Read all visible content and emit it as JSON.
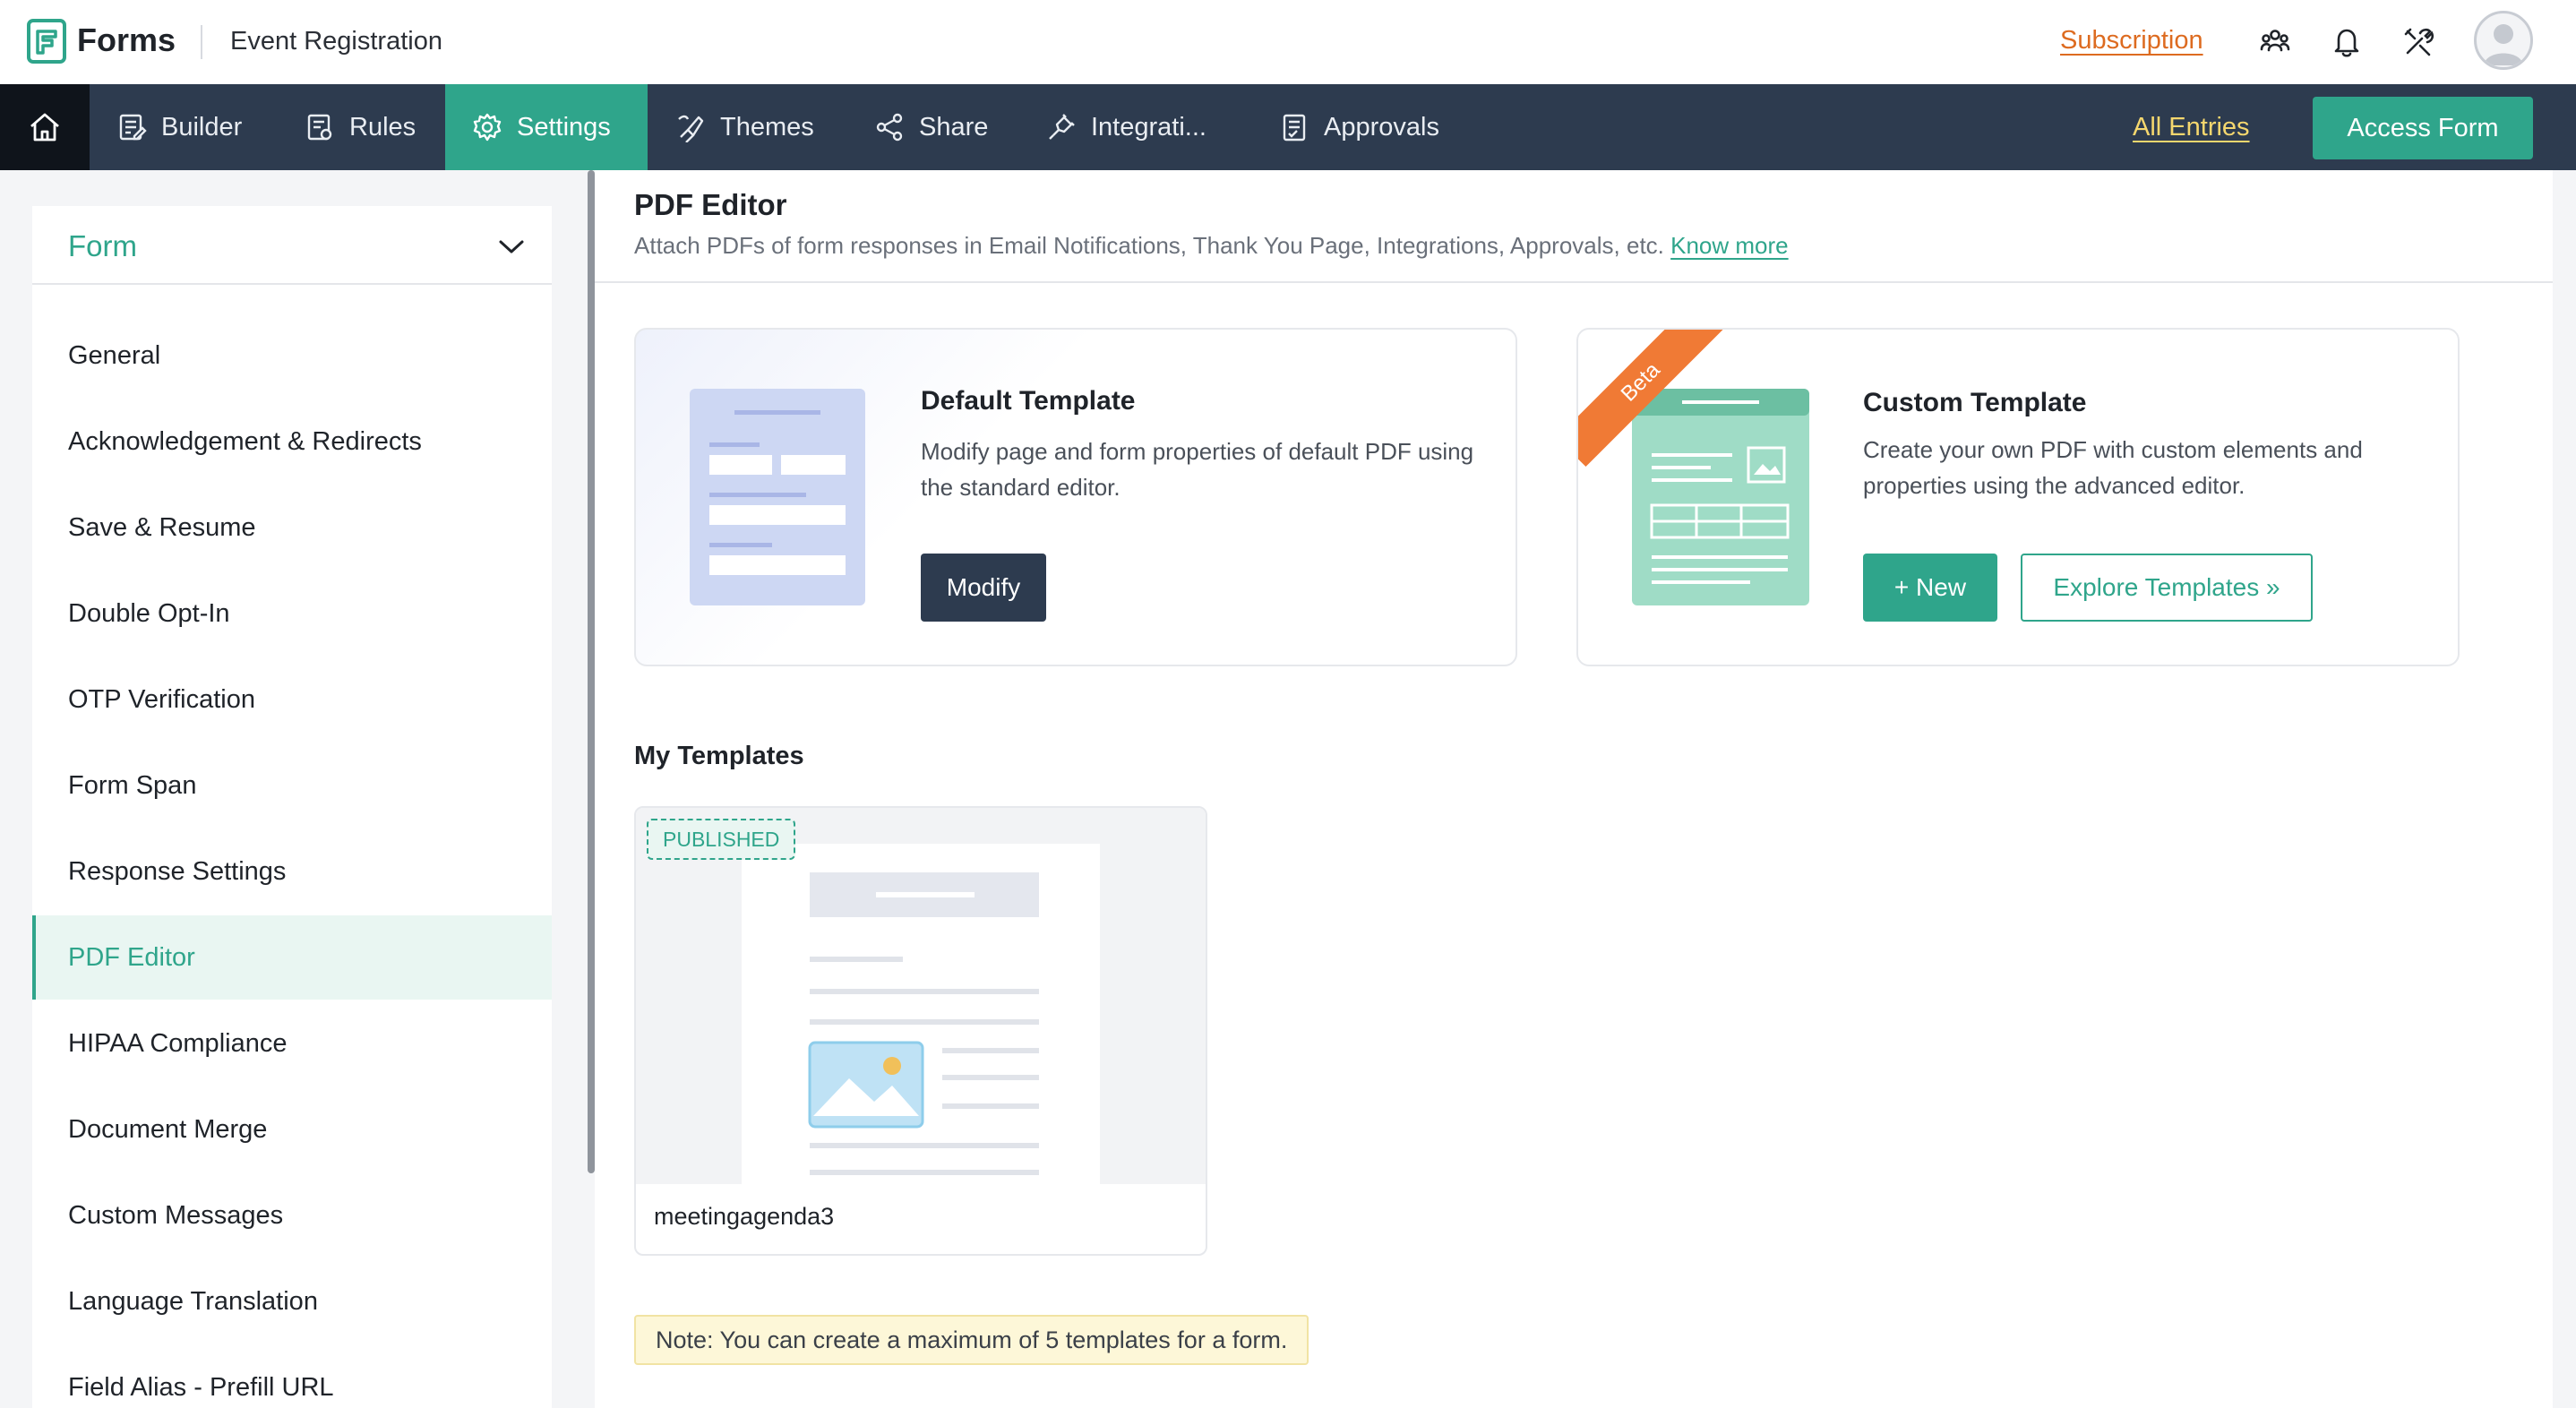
{
  "header": {
    "app_name": "Forms",
    "form_name": "Event Registration",
    "subscription_label": "Subscription",
    "icons": [
      "users-icon",
      "bell-icon",
      "tools-icon",
      "avatar"
    ]
  },
  "nav": {
    "home_icon": "home-icon",
    "tabs": [
      {
        "label": "Builder",
        "icon": "builder-icon"
      },
      {
        "label": "Rules",
        "icon": "rules-icon"
      },
      {
        "label": "Settings",
        "icon": "gear-icon"
      },
      {
        "label": "Themes",
        "icon": "themes-icon"
      },
      {
        "label": "Share",
        "icon": "share-icon"
      },
      {
        "label": "Integrati...",
        "icon": "integrations-icon"
      },
      {
        "label": "Approvals",
        "icon": "approvals-icon"
      }
    ],
    "active_tab": "Settings",
    "all_entries_label": "All Entries",
    "access_form_label": "Access Form"
  },
  "sidebar": {
    "dropdown_label": "Form",
    "items": [
      {
        "label": "General"
      },
      {
        "label": "Acknowledgement & Redirects"
      },
      {
        "label": "Save & Resume"
      },
      {
        "label": "Double Opt-In"
      },
      {
        "label": "OTP Verification"
      },
      {
        "label": "Form Span"
      },
      {
        "label": "Response Settings"
      },
      {
        "label": "PDF Editor"
      },
      {
        "label": "HIPAA Compliance"
      },
      {
        "label": "Document Merge"
      },
      {
        "label": "Custom Messages"
      },
      {
        "label": "Language Translation"
      },
      {
        "label": "Field Alias - Prefill URL"
      }
    ],
    "active_item": "PDF Editor"
  },
  "main": {
    "title": "PDF Editor",
    "description": "Attach PDFs of form responses in Email Notifications, Thank You Page, Integrations, Approvals, etc.",
    "know_more_label": "Know more",
    "default_template": {
      "title": "Default Template",
      "text": "Modify page and form properties of default PDF using the standard editor.",
      "button_label": "Modify"
    },
    "custom_template": {
      "ribbon_label": "Beta",
      "title": "Custom Template",
      "text": "Create your own PDF with custom elements and properties using the advanced editor.",
      "new_button_label": "+ New",
      "explore_button_label": "Explore Templates »"
    },
    "my_templates": {
      "title": "My Templates",
      "items": [
        {
          "name": "meetingagenda3",
          "status": "PUBLISHED"
        }
      ]
    },
    "note": "Note: You can create a maximum of 5 templates for a form."
  },
  "colors": {
    "brand_green": "#2fa58b",
    "navbar_bg": "#2d3b4f",
    "home_bg": "#0f141b",
    "subscription": "#dd6b20",
    "all_entries": "#f5d76e",
    "beta_ribbon": "#f07a35",
    "note_bg": "#fdf7d8"
  }
}
